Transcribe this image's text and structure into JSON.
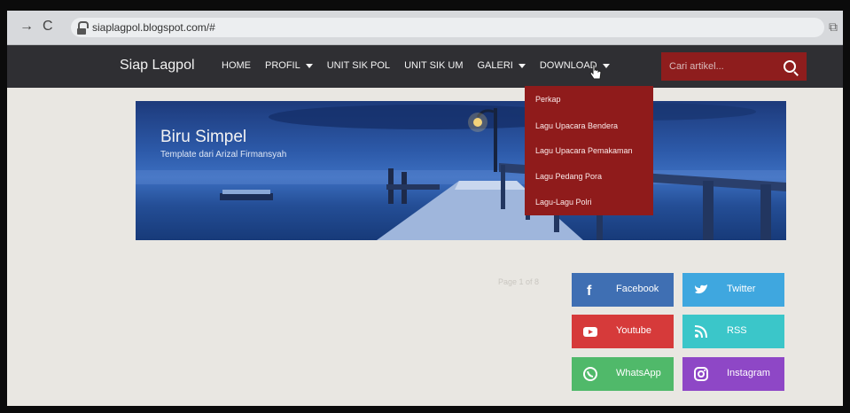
{
  "browser": {
    "url": "siaplagpol.blogspot.com/#"
  },
  "site": {
    "brand": "Siap Lagpol",
    "menu": [
      {
        "label": "HOME"
      },
      {
        "label": "PROFIL"
      },
      {
        "label": "UNIT SIK POL"
      },
      {
        "label": "UNIT SIK UM"
      },
      {
        "label": "GALERI"
      },
      {
        "label": "DOWNLOAD"
      }
    ],
    "search_placeholder": "Cari artikel..."
  },
  "dropdown": {
    "items": [
      {
        "label": "Perkap"
      },
      {
        "label": "Lagu Upacara Bendera"
      },
      {
        "label": "Lagu Upacara Pemakaman"
      },
      {
        "label": "Lagu Pedang Pora"
      },
      {
        "label": "Lagu-Lagu Polri"
      }
    ]
  },
  "banner": {
    "title": "Biru Simpel",
    "subtitle": "Template dari Arizal Firmansyah"
  },
  "pagination": {
    "text": "Page 1 of 8"
  },
  "social": {
    "facebook": "Facebook",
    "twitter": "Twitter",
    "youtube": "Youtube",
    "rss": "RSS",
    "whatsapp": "WhatsApp",
    "instagram": "Instagram"
  },
  "colors": {
    "nav_bg": "#2f2f33",
    "accent_red": "#8f1b1b",
    "facebook": "#3f6fb3",
    "twitter": "#3fa7df",
    "youtube": "#d63a3a",
    "rss": "#3bc6c9",
    "whatsapp": "#50b96a",
    "instagram": "#8e47c6"
  }
}
